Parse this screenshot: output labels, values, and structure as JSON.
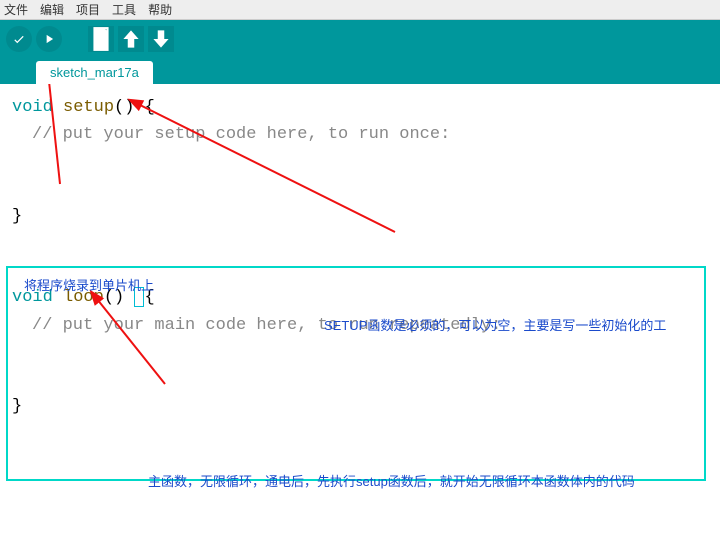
{
  "menu": {
    "file": "文件",
    "edit": "编辑",
    "project": "项目",
    "tools": "工具",
    "help": "帮助"
  },
  "toolbar": {
    "verify": "verify",
    "upload": "upload",
    "new": "new",
    "open": "open",
    "save": "save"
  },
  "tab": {
    "name": "sketch_mar17a"
  },
  "code": {
    "setup_sig_void": "void ",
    "setup_sig_name": "setup",
    "setup_sig_rest": "() {",
    "setup_comment": "// put your setup code here, to run once:",
    "close_brace1": "}",
    "loop_sig_void": "void ",
    "loop_sig_name": "loop",
    "loop_sig_rest": "() ",
    "loop_sig_brace": "{",
    "loop_comment": "// put your main code here, to run repeatedly:",
    "close_brace2": "}"
  },
  "annotations": {
    "upload_note": "将程序烧录到单片机上",
    "setup_note": "SETUP函数是必须的，可以为空，主要是写一些初始化的工",
    "loop_note": "主函数，无限循环，通电后，先执行setup函数后，就开始无限循环本函数体内的代码"
  }
}
